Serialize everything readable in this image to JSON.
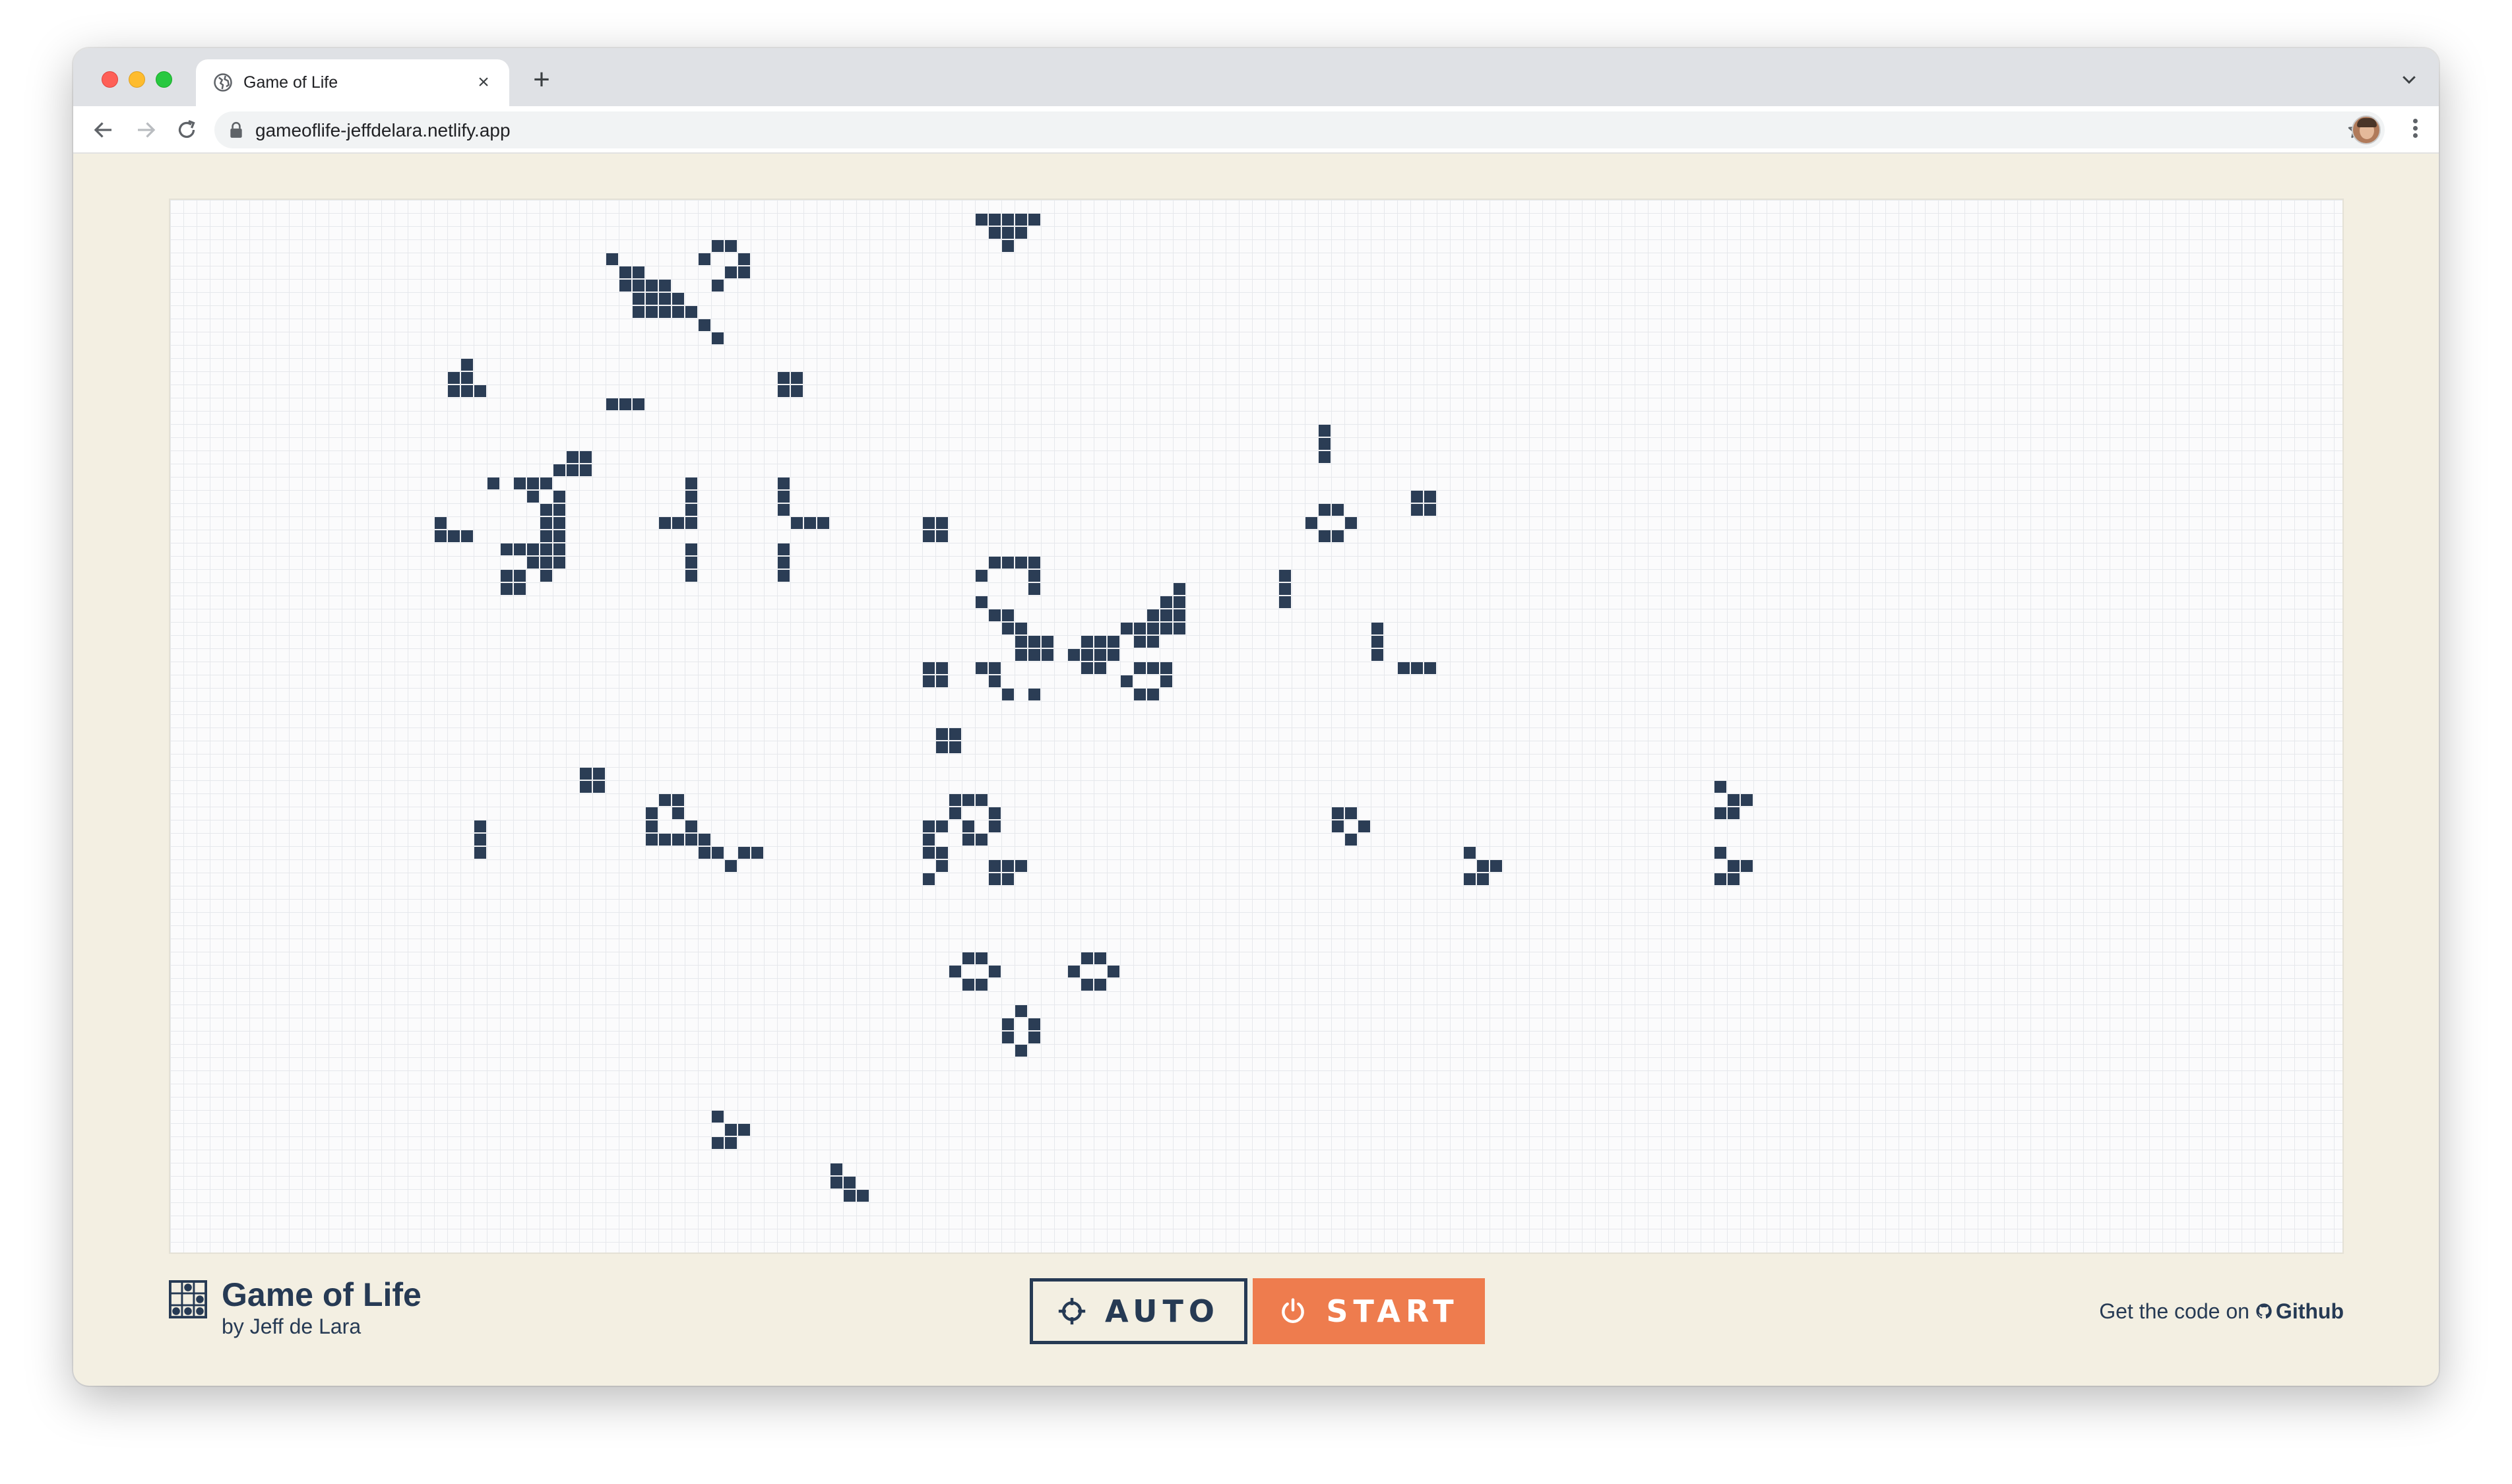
{
  "browser": {
    "tab_title": "Game of Life",
    "tab_close": "×",
    "new_tab": "+",
    "url": "gameoflife-jeffdelara.netlify.app"
  },
  "app": {
    "title": "Game of Life",
    "byline": "by Jeff de Lara",
    "auto_label": "AUTO",
    "start_label": "START",
    "code_prefix": "Get the code on",
    "code_link": "Github"
  },
  "board": {
    "live_color": "#2b3d55",
    "grid_color": "#e6e8ec",
    "live_cells": [
      [
        61,
        1
      ],
      [
        62,
        1
      ],
      [
        63,
        1
      ],
      [
        64,
        1
      ],
      [
        65,
        1
      ],
      [
        62,
        2
      ],
      [
        63,
        2
      ],
      [
        64,
        2
      ],
      [
        63,
        3
      ],
      [
        41,
        3
      ],
      [
        42,
        3
      ],
      [
        40,
        4
      ],
      [
        43,
        4
      ],
      [
        33,
        4
      ],
      [
        34,
        5
      ],
      [
        35,
        5
      ],
      [
        42,
        5
      ],
      [
        43,
        5
      ],
      [
        34,
        6
      ],
      [
        35,
        6
      ],
      [
        36,
        6
      ],
      [
        37,
        6
      ],
      [
        41,
        6
      ],
      [
        35,
        7
      ],
      [
        36,
        7
      ],
      [
        37,
        7
      ],
      [
        38,
        7
      ],
      [
        35,
        8
      ],
      [
        36,
        8
      ],
      [
        37,
        8
      ],
      [
        38,
        8
      ],
      [
        39,
        8
      ],
      [
        40,
        9
      ],
      [
        41,
        10
      ],
      [
        22,
        12
      ],
      [
        21,
        13
      ],
      [
        22,
        13
      ],
      [
        21,
        14
      ],
      [
        22,
        14
      ],
      [
        23,
        14
      ],
      [
        46,
        13
      ],
      [
        47,
        13
      ],
      [
        46,
        14
      ],
      [
        47,
        14
      ],
      [
        33,
        15
      ],
      [
        34,
        15
      ],
      [
        35,
        15
      ],
      [
        87,
        17
      ],
      [
        87,
        18
      ],
      [
        87,
        19
      ],
      [
        30,
        19
      ],
      [
        31,
        19
      ],
      [
        29,
        20
      ],
      [
        30,
        20
      ],
      [
        31,
        20
      ],
      [
        24,
        21
      ],
      [
        26,
        21
      ],
      [
        27,
        21
      ],
      [
        28,
        21
      ],
      [
        27,
        22
      ],
      [
        29,
        22
      ],
      [
        28,
        23
      ],
      [
        29,
        23
      ],
      [
        20,
        24
      ],
      [
        28,
        24
      ],
      [
        29,
        24
      ],
      [
        20,
        25
      ],
      [
        21,
        25
      ],
      [
        22,
        25
      ],
      [
        28,
        25
      ],
      [
        29,
        25
      ],
      [
        25,
        26
      ],
      [
        26,
        26
      ],
      [
        27,
        26
      ],
      [
        28,
        26
      ],
      [
        29,
        26
      ],
      [
        27,
        27
      ],
      [
        28,
        27
      ],
      [
        29,
        27
      ],
      [
        25,
        28
      ],
      [
        26,
        28
      ],
      [
        28,
        28
      ],
      [
        25,
        29
      ],
      [
        26,
        29
      ],
      [
        39,
        21
      ],
      [
        39,
        22
      ],
      [
        39,
        23
      ],
      [
        37,
        24
      ],
      [
        38,
        24
      ],
      [
        39,
        24
      ],
      [
        39,
        26
      ],
      [
        39,
        27
      ],
      [
        39,
        28
      ],
      [
        46,
        21
      ],
      [
        46,
        22
      ],
      [
        46,
        23
      ],
      [
        47,
        24
      ],
      [
        48,
        24
      ],
      [
        49,
        24
      ],
      [
        46,
        26
      ],
      [
        46,
        27
      ],
      [
        46,
        28
      ],
      [
        57,
        24
      ],
      [
        58,
        24
      ],
      [
        57,
        25
      ],
      [
        58,
        25
      ],
      [
        94,
        22
      ],
      [
        95,
        22
      ],
      [
        94,
        23
      ],
      [
        95,
        23
      ],
      [
        87,
        23
      ],
      [
        88,
        23
      ],
      [
        86,
        24
      ],
      [
        89,
        24
      ],
      [
        87,
        25
      ],
      [
        88,
        25
      ],
      [
        62,
        27
      ],
      [
        63,
        27
      ],
      [
        64,
        27
      ],
      [
        65,
        27
      ],
      [
        65,
        28
      ],
      [
        61,
        28
      ],
      [
        65,
        29
      ],
      [
        61,
        30
      ],
      [
        84,
        28
      ],
      [
        84,
        29
      ],
      [
        84,
        30
      ],
      [
        76,
        29
      ],
      [
        75,
        30
      ],
      [
        76,
        30
      ],
      [
        74,
        31
      ],
      [
        75,
        31
      ],
      [
        76,
        31
      ],
      [
        62,
        31
      ],
      [
        63,
        31
      ],
      [
        74,
        32
      ],
      [
        75,
        32
      ],
      [
        76,
        32
      ],
      [
        63,
        32
      ],
      [
        64,
        32
      ],
      [
        72,
        32
      ],
      [
        73,
        32
      ],
      [
        91,
        32
      ],
      [
        91,
        33
      ],
      [
        91,
        34
      ],
      [
        64,
        33
      ],
      [
        65,
        33
      ],
      [
        66,
        33
      ],
      [
        69,
        33
      ],
      [
        70,
        33
      ],
      [
        71,
        33
      ],
      [
        73,
        33
      ],
      [
        74,
        33
      ],
      [
        64,
        34
      ],
      [
        65,
        34
      ],
      [
        66,
        34
      ],
      [
        68,
        34
      ],
      [
        69,
        34
      ],
      [
        70,
        34
      ],
      [
        71,
        34
      ],
      [
        69,
        35
      ],
      [
        70,
        35
      ],
      [
        93,
        35
      ],
      [
        94,
        35
      ],
      [
        95,
        35
      ],
      [
        61,
        35
      ],
      [
        62,
        35
      ],
      [
        62,
        36
      ],
      [
        57,
        35
      ],
      [
        58,
        35
      ],
      [
        57,
        36
      ],
      [
        58,
        36
      ],
      [
        73,
        35
      ],
      [
        74,
        35
      ],
      [
        75,
        35
      ],
      [
        63,
        37
      ],
      [
        65,
        37
      ],
      [
        72,
        36
      ],
      [
        75,
        36
      ],
      [
        73,
        37
      ],
      [
        74,
        37
      ],
      [
        58,
        40
      ],
      [
        59,
        40
      ],
      [
        58,
        41
      ],
      [
        59,
        41
      ],
      [
        31,
        43
      ],
      [
        32,
        43
      ],
      [
        31,
        44
      ],
      [
        32,
        44
      ],
      [
        117,
        44
      ],
      [
        118,
        45
      ],
      [
        119,
        45
      ],
      [
        117,
        46
      ],
      [
        118,
        46
      ],
      [
        37,
        45
      ],
      [
        38,
        45
      ],
      [
        59,
        45
      ],
      [
        60,
        45
      ],
      [
        61,
        45
      ],
      [
        36,
        46
      ],
      [
        38,
        46
      ],
      [
        59,
        46
      ],
      [
        62,
        46
      ],
      [
        88,
        46
      ],
      [
        89,
        46
      ],
      [
        36,
        47
      ],
      [
        39,
        47
      ],
      [
        57,
        47
      ],
      [
        58,
        47
      ],
      [
        60,
        47
      ],
      [
        62,
        47
      ],
      [
        88,
        47
      ],
      [
        90,
        47
      ],
      [
        23,
        47
      ],
      [
        23,
        48
      ],
      [
        23,
        49
      ],
      [
        36,
        48
      ],
      [
        37,
        48
      ],
      [
        38,
        48
      ],
      [
        39,
        48
      ],
      [
        40,
        48
      ],
      [
        57,
        48
      ],
      [
        60,
        48
      ],
      [
        61,
        48
      ],
      [
        89,
        48
      ],
      [
        40,
        49
      ],
      [
        41,
        49
      ],
      [
        43,
        49
      ],
      [
        44,
        49
      ],
      [
        57,
        49
      ],
      [
        58,
        49
      ],
      [
        98,
        49
      ],
      [
        117,
        49
      ],
      [
        42,
        50
      ],
      [
        58,
        50
      ],
      [
        62,
        50
      ],
      [
        63,
        50
      ],
      [
        64,
        50
      ],
      [
        99,
        50
      ],
      [
        100,
        50
      ],
      [
        118,
        50
      ],
      [
        119,
        50
      ],
      [
        57,
        51
      ],
      [
        62,
        51
      ],
      [
        63,
        51
      ],
      [
        98,
        51
      ],
      [
        99,
        51
      ],
      [
        117,
        51
      ],
      [
        118,
        51
      ],
      [
        60,
        57
      ],
      [
        61,
        57
      ],
      [
        69,
        57
      ],
      [
        70,
        57
      ],
      [
        59,
        58
      ],
      [
        62,
        58
      ],
      [
        68,
        58
      ],
      [
        71,
        58
      ],
      [
        60,
        59
      ],
      [
        61,
        59
      ],
      [
        69,
        59
      ],
      [
        70,
        59
      ],
      [
        64,
        61
      ],
      [
        63,
        62
      ],
      [
        65,
        62
      ],
      [
        63,
        63
      ],
      [
        65,
        63
      ],
      [
        64,
        64
      ],
      [
        41,
        69
      ],
      [
        42,
        70
      ],
      [
        43,
        70
      ],
      [
        41,
        71
      ],
      [
        42,
        71
      ],
      [
        50,
        73
      ],
      [
        50,
        74
      ],
      [
        51,
        74
      ],
      [
        51,
        75
      ],
      [
        52,
        75
      ]
    ]
  }
}
